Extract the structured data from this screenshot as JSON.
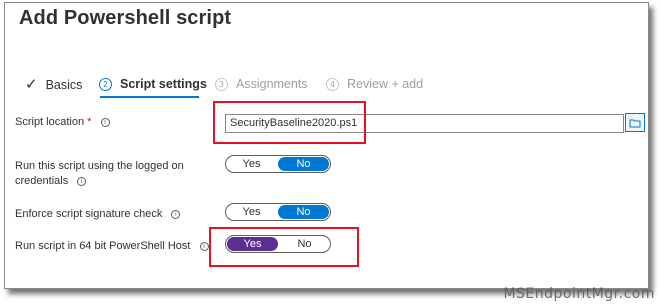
{
  "page": {
    "title": "Add Powershell script",
    "watermark": "MSEndpointMgr.com"
  },
  "wizard": {
    "steps": [
      {
        "label": "Basics",
        "number": "",
        "state": "complete"
      },
      {
        "label": "Script settings",
        "number": "2",
        "state": "active"
      },
      {
        "label": "Assignments",
        "number": "3",
        "state": "disabled"
      },
      {
        "label": "Review + add",
        "number": "4",
        "state": "disabled"
      }
    ]
  },
  "form": {
    "script_location": {
      "label": "Script location",
      "required_mark": "*",
      "value": "SecurityBaseline2020.ps1"
    },
    "run_logged_on": {
      "label": "Run this script using the logged on credentials",
      "yes": "Yes",
      "no": "No",
      "selected": "No"
    },
    "signature_check": {
      "label": "Enforce script signature check",
      "yes": "Yes",
      "no": "No",
      "selected": "No"
    },
    "run_64bit": {
      "label": "Run script in 64 bit PowerShell Host",
      "yes": "Yes",
      "no": "No",
      "selected": "Yes"
    }
  },
  "colors": {
    "accent": "#0078d4",
    "selected_purple": "#5c2e91",
    "highlight_red": "#e81123"
  }
}
